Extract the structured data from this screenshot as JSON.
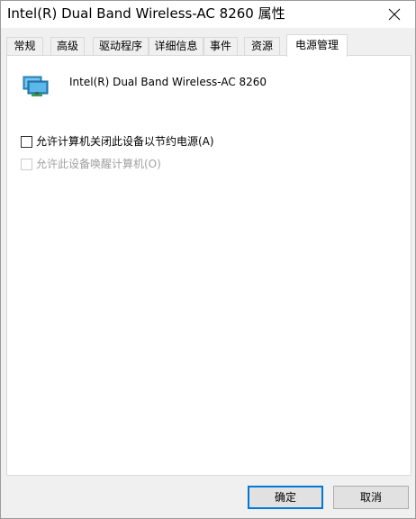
{
  "window": {
    "title": "Intel(R) Dual Band Wireless-AC 8260 属性"
  },
  "tabs": [
    {
      "label": "常规"
    },
    {
      "label": "高级"
    },
    {
      "label": "驱动程序"
    },
    {
      "label": "详细信息"
    },
    {
      "label": "事件"
    },
    {
      "label": "资源"
    },
    {
      "label": "电源管理",
      "active": true
    }
  ],
  "device": {
    "name": "Intel(R) Dual Band Wireless-AC 8260",
    "icon": "network-adapter-icon"
  },
  "options": [
    {
      "label": "允许计算机关闭此设备以节约电源(A)",
      "checked": false,
      "enabled": true
    },
    {
      "label": "允许此设备唤醒计算机(O)",
      "checked": false,
      "enabled": false
    }
  ],
  "buttons": {
    "ok": "确定",
    "cancel": "取消"
  },
  "colors": {
    "accent": "#0078d7",
    "dialog_bg": "#f0f0f0",
    "panel_bg": "#ffffff"
  }
}
